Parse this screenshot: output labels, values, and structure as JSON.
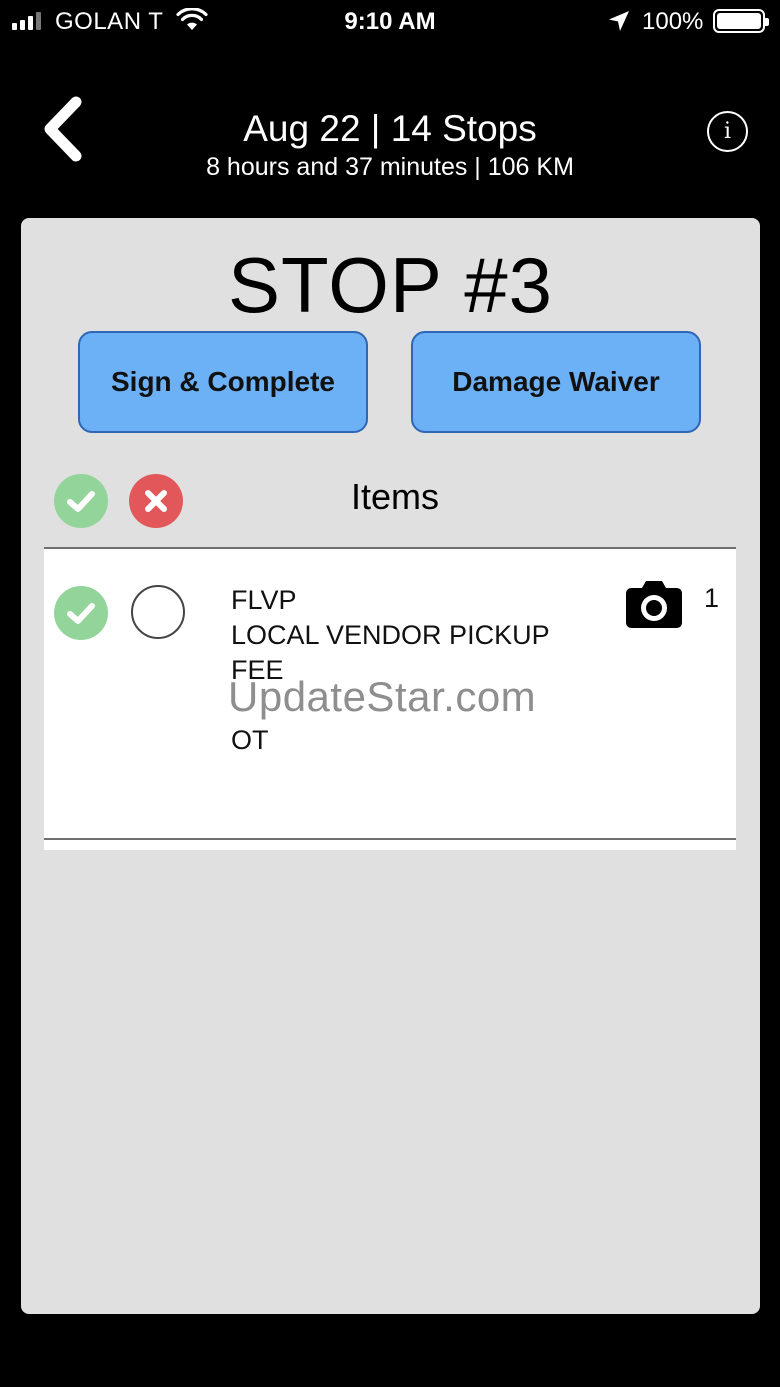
{
  "status_bar": {
    "carrier": "GOLAN T",
    "time": "9:10 AM",
    "battery": "100%"
  },
  "header": {
    "title": "Aug 22 | 14 Stops",
    "subtitle": "8 hours and 37 minutes | 106 KM",
    "back_icon": "chevron-left-icon",
    "info_icon": "info-icon",
    "info_glyph": "i"
  },
  "stop": {
    "title": "STOP #3",
    "buttons": {
      "sign_complete": "Sign & Complete",
      "damage_waiver": "Damage Waiver"
    }
  },
  "items": {
    "label": "Items",
    "header_icons": [
      "check-circle-icon",
      "x-circle-icon"
    ],
    "rows": [
      {
        "lines": [
          "FLVP",
          "LOCAL VENDOR PICKUP",
          "FEE",
          "",
          "OT"
        ],
        "quantity": "1",
        "icons": [
          "check-circle-icon",
          "radio-unchecked-icon",
          "camera-icon"
        ]
      }
    ]
  },
  "watermark": "UpdateStar.com",
  "colors": {
    "background": "#000000",
    "card": "#e0e0e0",
    "button": "#6cb0f6",
    "button_border": "#2f66b5",
    "check_green": "#93d49a",
    "cancel_red": "#e2575a"
  }
}
